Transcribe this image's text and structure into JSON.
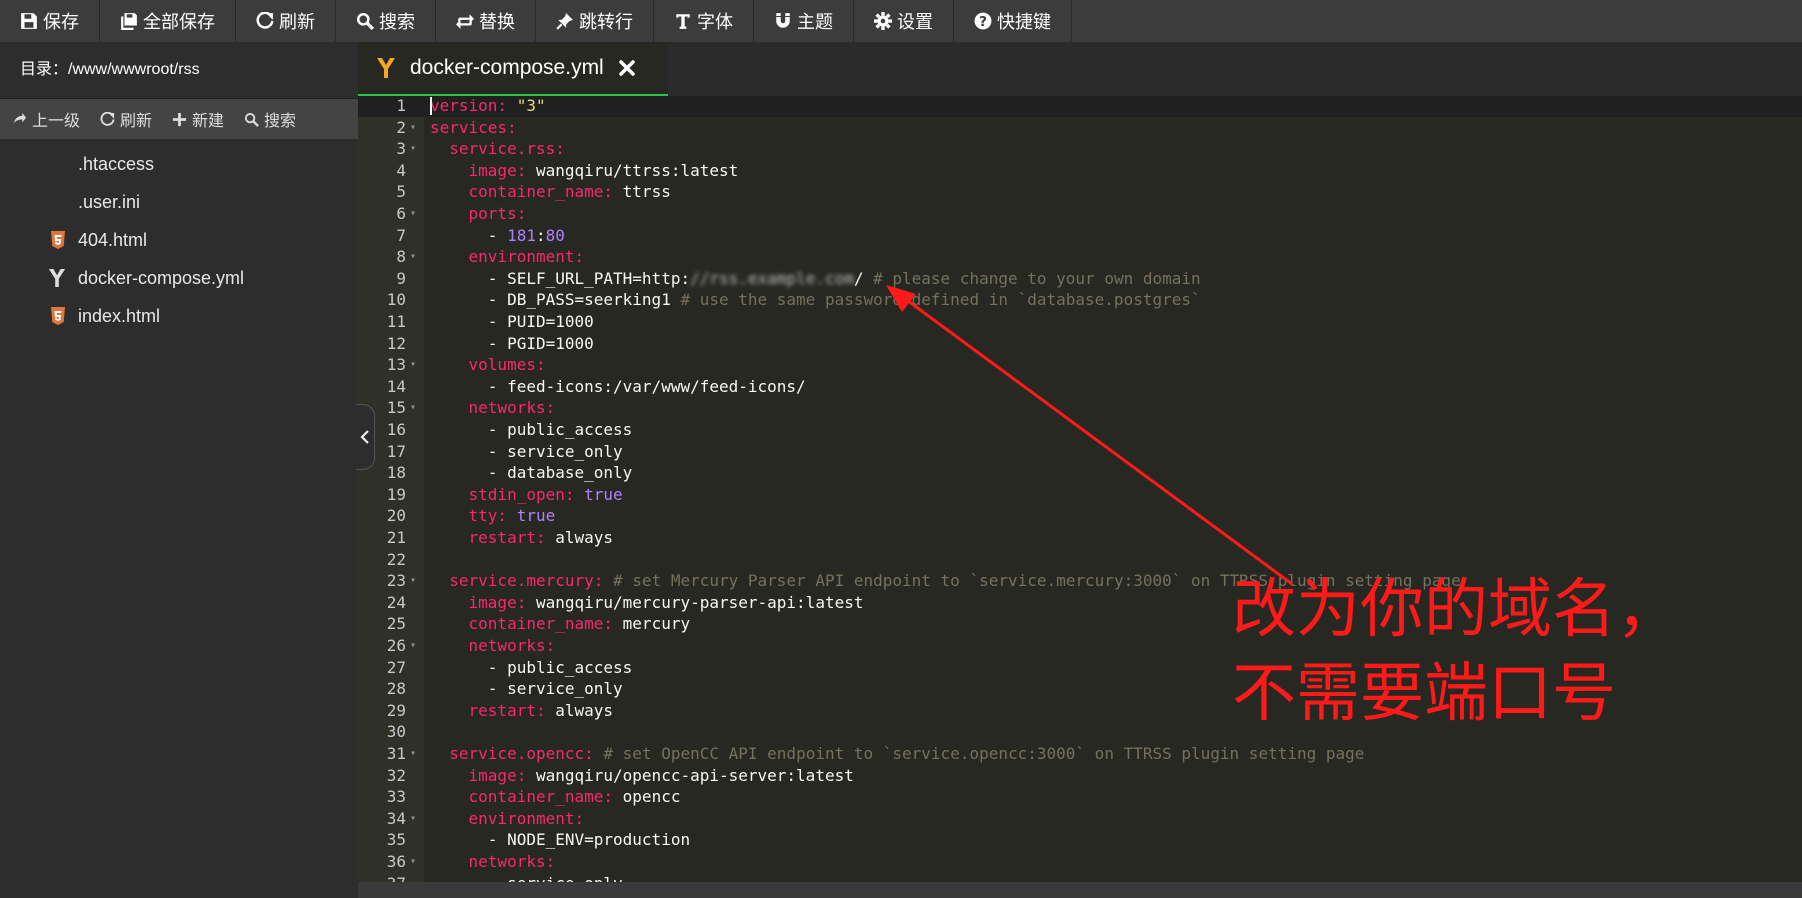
{
  "toolbar": {
    "items": [
      {
        "label": "保存",
        "icon": "save-icon"
      },
      {
        "label": "全部保存",
        "icon": "save-all-icon"
      },
      {
        "label": "刷新",
        "icon": "refresh-icon"
      },
      {
        "label": "搜索",
        "icon": "search-icon"
      },
      {
        "label": "替换",
        "icon": "replace-icon"
      },
      {
        "label": "跳转行",
        "icon": "pin-icon"
      },
      {
        "label": "字体",
        "icon": "text-icon"
      },
      {
        "label": "主题",
        "icon": "magnet-icon"
      },
      {
        "label": "设置",
        "icon": "gear-icon"
      },
      {
        "label": "快捷键",
        "icon": "question-icon"
      }
    ]
  },
  "sidebar": {
    "directory_label": "目录：/www/wwwroot/rss",
    "tools": {
      "up": "上一级",
      "refresh": "刷新",
      "new": "新建",
      "search": "搜索"
    },
    "files": [
      {
        "name": ".htaccess",
        "icon": "none"
      },
      {
        "name": ".user.ini",
        "icon": "none"
      },
      {
        "name": "404.html",
        "icon": "html5-icon"
      },
      {
        "name": "docker-compose.yml",
        "icon": "yaml-icon"
      },
      {
        "name": "index.html",
        "icon": "html5-icon"
      }
    ]
  },
  "tab": {
    "title": "docker-compose.yml"
  },
  "editor": {
    "lines": [
      {
        "n": "1",
        "fold": false,
        "seg": [
          [
            "k",
            "version:"
          ],
          [
            "t",
            " "
          ],
          [
            "s",
            "\"3\""
          ]
        ]
      },
      {
        "n": "2",
        "fold": true,
        "seg": [
          [
            "k",
            "services:"
          ]
        ]
      },
      {
        "n": "3",
        "fold": true,
        "seg": [
          [
            "t",
            "  "
          ],
          [
            "k",
            "service.rss:"
          ]
        ]
      },
      {
        "n": "4",
        "fold": false,
        "seg": [
          [
            "t",
            "    "
          ],
          [
            "k",
            "image:"
          ],
          [
            "t",
            " wangqiru/ttrss:latest"
          ]
        ]
      },
      {
        "n": "5",
        "fold": false,
        "seg": [
          [
            "t",
            "    "
          ],
          [
            "k",
            "container_name:"
          ],
          [
            "t",
            " ttrss"
          ]
        ]
      },
      {
        "n": "6",
        "fold": true,
        "seg": [
          [
            "t",
            "    "
          ],
          [
            "k",
            "ports:"
          ]
        ]
      },
      {
        "n": "7",
        "fold": false,
        "seg": [
          [
            "t",
            "      - "
          ],
          [
            "n",
            "181"
          ],
          [
            "t",
            ":"
          ],
          [
            "n",
            "80"
          ]
        ]
      },
      {
        "n": "8",
        "fold": true,
        "seg": [
          [
            "t",
            "    "
          ],
          [
            "k",
            "environment:"
          ]
        ]
      },
      {
        "n": "9",
        "fold": false,
        "seg": [
          [
            "t",
            "      - SELF_URL_PATH=http:"
          ],
          [
            "blur",
            "//rss.example.com"
          ],
          [
            "t",
            "/ "
          ],
          [
            "c",
            "# please change to your own domain"
          ]
        ]
      },
      {
        "n": "10",
        "fold": false,
        "seg": [
          [
            "t",
            "      - DB_PASS=seerking1 "
          ],
          [
            "c",
            "# use the same password defined in `database.postgres`"
          ]
        ]
      },
      {
        "n": "11",
        "fold": false,
        "seg": [
          [
            "t",
            "      - PUID=1000"
          ]
        ]
      },
      {
        "n": "12",
        "fold": false,
        "seg": [
          [
            "t",
            "      - PGID=1000"
          ]
        ]
      },
      {
        "n": "13",
        "fold": true,
        "seg": [
          [
            "t",
            "    "
          ],
          [
            "k",
            "volumes:"
          ]
        ]
      },
      {
        "n": "14",
        "fold": false,
        "seg": [
          [
            "t",
            "      - feed-icons:/var/www/feed-icons/"
          ]
        ]
      },
      {
        "n": "15",
        "fold": true,
        "seg": [
          [
            "t",
            "    "
          ],
          [
            "k",
            "networks:"
          ]
        ]
      },
      {
        "n": "16",
        "fold": false,
        "seg": [
          [
            "t",
            "      - public_access"
          ]
        ]
      },
      {
        "n": "17",
        "fold": false,
        "seg": [
          [
            "t",
            "      - service_only"
          ]
        ]
      },
      {
        "n": "18",
        "fold": false,
        "seg": [
          [
            "t",
            "      - database_only"
          ]
        ]
      },
      {
        "n": "19",
        "fold": false,
        "seg": [
          [
            "t",
            "    "
          ],
          [
            "k",
            "stdin_open:"
          ],
          [
            "t",
            " "
          ],
          [
            "n",
            "true"
          ]
        ]
      },
      {
        "n": "20",
        "fold": false,
        "seg": [
          [
            "t",
            "    "
          ],
          [
            "k",
            "tty:"
          ],
          [
            "t",
            " "
          ],
          [
            "n",
            "true"
          ]
        ]
      },
      {
        "n": "21",
        "fold": false,
        "seg": [
          [
            "t",
            "    "
          ],
          [
            "k",
            "restart:"
          ],
          [
            "t",
            " always"
          ]
        ]
      },
      {
        "n": "22",
        "fold": false,
        "seg": []
      },
      {
        "n": "23",
        "fold": true,
        "seg": [
          [
            "t",
            "  "
          ],
          [
            "k",
            "service.mercury:"
          ],
          [
            "t",
            " "
          ],
          [
            "c",
            "# set Mercury Parser API endpoint to `service.mercury:3000` on TTRSS plugin setting page"
          ]
        ]
      },
      {
        "n": "24",
        "fold": false,
        "seg": [
          [
            "t",
            "    "
          ],
          [
            "k",
            "image:"
          ],
          [
            "t",
            " wangqiru/mercury-parser-api:latest"
          ]
        ]
      },
      {
        "n": "25",
        "fold": false,
        "seg": [
          [
            "t",
            "    "
          ],
          [
            "k",
            "container_name:"
          ],
          [
            "t",
            " mercury"
          ]
        ]
      },
      {
        "n": "26",
        "fold": true,
        "seg": [
          [
            "t",
            "    "
          ],
          [
            "k",
            "networks:"
          ]
        ]
      },
      {
        "n": "27",
        "fold": false,
        "seg": [
          [
            "t",
            "      - public_access"
          ]
        ]
      },
      {
        "n": "28",
        "fold": false,
        "seg": [
          [
            "t",
            "      - service_only"
          ]
        ]
      },
      {
        "n": "29",
        "fold": false,
        "seg": [
          [
            "t",
            "    "
          ],
          [
            "k",
            "restart:"
          ],
          [
            "t",
            " always"
          ]
        ]
      },
      {
        "n": "30",
        "fold": false,
        "seg": []
      },
      {
        "n": "31",
        "fold": true,
        "seg": [
          [
            "t",
            "  "
          ],
          [
            "k",
            "service.opencc:"
          ],
          [
            "t",
            " "
          ],
          [
            "c",
            "# set OpenCC API endpoint to `service.opencc:3000` on TTRSS plugin setting page"
          ]
        ]
      },
      {
        "n": "32",
        "fold": false,
        "seg": [
          [
            "t",
            "    "
          ],
          [
            "k",
            "image:"
          ],
          [
            "t",
            " wangqiru/opencc-api-server:latest"
          ]
        ]
      },
      {
        "n": "33",
        "fold": false,
        "seg": [
          [
            "t",
            "    "
          ],
          [
            "k",
            "container_name:"
          ],
          [
            "t",
            " opencc"
          ]
        ]
      },
      {
        "n": "34",
        "fold": true,
        "seg": [
          [
            "t",
            "    "
          ],
          [
            "k",
            "environment:"
          ]
        ]
      },
      {
        "n": "35",
        "fold": false,
        "seg": [
          [
            "t",
            "      - NODE_ENV=production"
          ]
        ]
      },
      {
        "n": "36",
        "fold": true,
        "seg": [
          [
            "t",
            "    "
          ],
          [
            "k",
            "networks:"
          ]
        ]
      },
      {
        "n": "37",
        "fold": false,
        "seg": [
          [
            "t",
            "      - service_only"
          ]
        ]
      }
    ]
  },
  "annotation": {
    "line1": "改为你的域名，",
    "line2": "不需要端口号",
    "color": "#ff1a1a"
  },
  "colors": {
    "accent_tab": "#29c74b",
    "yaml_icon": "#f5a623",
    "html_icon": "#e0763c"
  }
}
